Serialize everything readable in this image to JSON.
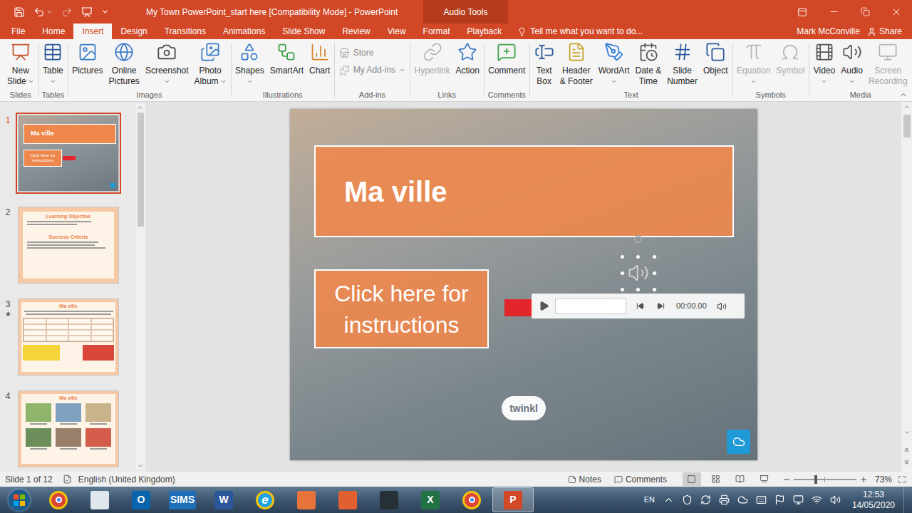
{
  "window": {
    "title": "My Town PowerPoint_start here [Compatibility Mode] - PowerPoint",
    "contextual_group": "Audio Tools"
  },
  "tabs": [
    {
      "label": "File",
      "selected": false,
      "contextual": false
    },
    {
      "label": "Home",
      "selected": false,
      "contextual": false
    },
    {
      "label": "Insert",
      "selected": true,
      "contextual": false
    },
    {
      "label": "Design",
      "selected": false,
      "contextual": false
    },
    {
      "label": "Transitions",
      "selected": false,
      "contextual": false
    },
    {
      "label": "Animations",
      "selected": false,
      "contextual": false
    },
    {
      "label": "Slide Show",
      "selected": false,
      "contextual": false
    },
    {
      "label": "Review",
      "selected": false,
      "contextual": false
    },
    {
      "label": "View",
      "selected": false,
      "contextual": false
    },
    {
      "label": "Format",
      "selected": false,
      "contextual": true
    },
    {
      "label": "Playback",
      "selected": false,
      "contextual": true
    }
  ],
  "tell_me": "Tell me what you want to do...",
  "account": {
    "user": "Mark McConville",
    "share": "Share"
  },
  "ribbon": {
    "groups": [
      {
        "label": "Slides",
        "buttons": [
          {
            "kind": "large",
            "lines": [
              "New",
              "Slide"
            ],
            "dropdown": true,
            "disabled": false
          }
        ]
      },
      {
        "label": "Tables",
        "buttons": [
          {
            "kind": "large",
            "lines": [
              "Table"
            ],
            "dropdown": true,
            "disabled": false
          }
        ]
      },
      {
        "label": "Images",
        "buttons": [
          {
            "kind": "large",
            "lines": [
              "Pictures"
            ],
            "dropdown": false,
            "disabled": false
          },
          {
            "kind": "large",
            "lines": [
              "Online",
              "Pictures"
            ],
            "dropdown": false,
            "disabled": false
          },
          {
            "kind": "large",
            "lines": [
              "Screenshot"
            ],
            "dropdown": true,
            "disabled": false
          },
          {
            "kind": "large",
            "lines": [
              "Photo",
              "Album"
            ],
            "dropdown": true,
            "disabled": false
          }
        ]
      },
      {
        "label": "Illustrations",
        "buttons": [
          {
            "kind": "large",
            "lines": [
              "Shapes"
            ],
            "dropdown": true,
            "disabled": false
          },
          {
            "kind": "large",
            "lines": [
              "SmartArt"
            ],
            "dropdown": false,
            "disabled": false
          },
          {
            "kind": "large",
            "lines": [
              "Chart"
            ],
            "dropdown": false,
            "disabled": false
          }
        ]
      },
      {
        "label": "Add-ins",
        "buttons": [
          {
            "kind": "small",
            "lines": [
              "Store"
            ],
            "dropdown": false,
            "disabled": true
          },
          {
            "kind": "small",
            "lines": [
              "My Add-ins"
            ],
            "dropdown": true,
            "disabled": true
          }
        ]
      },
      {
        "label": "Links",
        "buttons": [
          {
            "kind": "large",
            "lines": [
              "Hyperlink"
            ],
            "dropdown": false,
            "disabled": true
          },
          {
            "kind": "large",
            "lines": [
              "Action"
            ],
            "dropdown": false,
            "disabled": false
          }
        ]
      },
      {
        "label": "Comments",
        "buttons": [
          {
            "kind": "large",
            "lines": [
              "Comment"
            ],
            "dropdown": false,
            "disabled": false
          }
        ]
      },
      {
        "label": "Text",
        "buttons": [
          {
            "kind": "large",
            "lines": [
              "Text",
              "Box"
            ],
            "dropdown": false,
            "disabled": false
          },
          {
            "kind": "large",
            "lines": [
              "Header",
              "& Footer"
            ],
            "dropdown": false,
            "disabled": false
          },
          {
            "kind": "large",
            "lines": [
              "WordArt"
            ],
            "dropdown": true,
            "disabled": false
          },
          {
            "kind": "large",
            "lines": [
              "Date &",
              "Time"
            ],
            "dropdown": false,
            "disabled": false
          },
          {
            "kind": "large",
            "lines": [
              "Slide",
              "Number"
            ],
            "dropdown": false,
            "disabled": false
          },
          {
            "kind": "large",
            "lines": [
              "Object"
            ],
            "dropdown": false,
            "disabled": false
          }
        ]
      },
      {
        "label": "Symbols",
        "buttons": [
          {
            "kind": "large",
            "lines": [
              "Equation"
            ],
            "dropdown": true,
            "disabled": true
          },
          {
            "kind": "large",
            "lines": [
              "Symbol"
            ],
            "dropdown": false,
            "disabled": true
          }
        ]
      },
      {
        "label": "Media",
        "buttons": [
          {
            "kind": "large",
            "lines": [
              "Video"
            ],
            "dropdown": true,
            "disabled": false
          },
          {
            "kind": "large",
            "lines": [
              "Audio"
            ],
            "dropdown": true,
            "disabled": false
          },
          {
            "kind": "large",
            "lines": [
              "Screen",
              "Recording"
            ],
            "dropdown": false,
            "disabled": true
          }
        ]
      }
    ]
  },
  "thumbnails": [
    {
      "number": "1",
      "selected": true,
      "animated": false,
      "kind": "title",
      "title": "Ma ville",
      "subtitle": "Click here for instructions"
    },
    {
      "number": "2",
      "selected": false,
      "animated": false,
      "kind": "objectives",
      "title": "Learning Objective",
      "subtitle": "Success Criteria"
    },
    {
      "number": "3",
      "selected": false,
      "animated": true,
      "kind": "vocab",
      "title": "Ma ville",
      "subtitle": ""
    },
    {
      "number": "4",
      "selected": false,
      "animated": false,
      "kind": "pictures",
      "title": "Ma ville",
      "subtitle": ""
    }
  ],
  "slide": {
    "title": "Ma ville",
    "instructions_button": "Click here for instructions",
    "audio": {
      "selected": true,
      "time": "00:00.00",
      "level": 0
    },
    "logo": "twinkl"
  },
  "status_bar": {
    "slide_info": "Slide 1 of 12",
    "language": "English (United Kingdom)",
    "notes": "Notes",
    "comments": "Comments",
    "views": [
      {
        "selected": true
      },
      {
        "selected": false
      },
      {
        "selected": false
      },
      {
        "selected": false
      }
    ],
    "zoom": "73%",
    "zoom_level": 0.35
  },
  "taskbar": {
    "apps": [
      {
        "kind": "circle",
        "glyph": "",
        "color": "#db4437",
        "selected": false
      },
      {
        "kind": "tile",
        "glyph": "",
        "color": "#dfe6ee",
        "selected": false
      },
      {
        "kind": "tile",
        "glyph": "O",
        "color": "#0a64ad",
        "selected": false
      },
      {
        "kind": "tile",
        "glyph": "SIMS",
        "color": "#1e6fb8",
        "selected": false
      },
      {
        "kind": "tile",
        "glyph": "W",
        "color": "#2b579a",
        "selected": false
      },
      {
        "kind": "circle",
        "glyph": "e",
        "color": "#1ea1e1",
        "selected": false
      },
      {
        "kind": "tile",
        "glyph": "",
        "color": "#e8743b",
        "selected": false
      },
      {
        "kind": "tile",
        "glyph": "",
        "color": "#e0612f",
        "selected": false
      },
      {
        "kind": "tile",
        "glyph": "",
        "color": "#263238",
        "selected": false
      },
      {
        "kind": "tile",
        "glyph": "X",
        "color": "#217346",
        "selected": false
      },
      {
        "kind": "circle",
        "glyph": "",
        "color": "#db4437",
        "selected": false
      },
      {
        "kind": "tile",
        "glyph": "P",
        "color": "#d24726",
        "selected": true
      }
    ],
    "language": "EN",
    "time": "12:53",
    "date": "14/05/2020"
  }
}
